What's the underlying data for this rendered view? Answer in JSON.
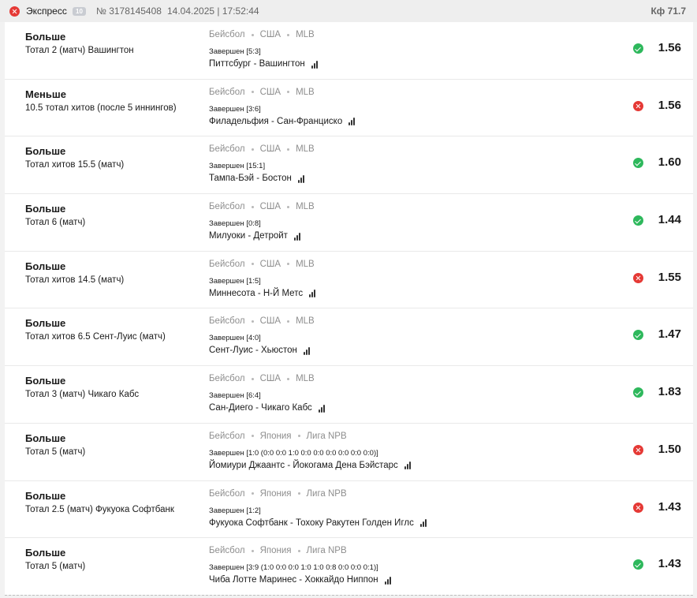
{
  "header": {
    "type": "Экспресс",
    "count": "10",
    "number": "№ 3178145408",
    "datetime": "14.04.2025 | 17:52:44",
    "coef": "Кф 71.7",
    "status": "lost"
  },
  "bets": [
    {
      "pick": "Больше",
      "market": "Тотал 2 (матч) Вашингтон",
      "sport": "Бейсбол",
      "country": "США",
      "league": "MLB",
      "result": "Завершен [5:3]",
      "match": "Питтсбург - Вашингтон",
      "status": "won",
      "odds": "1.56"
    },
    {
      "pick": "Меньше",
      "market": "10.5 тотал хитов (после 5 иннингов)",
      "sport": "Бейсбол",
      "country": "США",
      "league": "MLB",
      "result": "Завершен [3:6]",
      "match": "Филадельфия - Сан-Франциско",
      "status": "lost",
      "odds": "1.56"
    },
    {
      "pick": "Больше",
      "market": "Тотал хитов 15.5 (матч)",
      "sport": "Бейсбол",
      "country": "США",
      "league": "MLB",
      "result": "Завершен [15:1]",
      "match": "Тампа-Бэй - Бостон",
      "status": "won",
      "odds": "1.60"
    },
    {
      "pick": "Больше",
      "market": "Тотал 6 (матч)",
      "sport": "Бейсбол",
      "country": "США",
      "league": "MLB",
      "result": "Завершен [0:8]",
      "match": "Милуоки - Детройт",
      "status": "won",
      "odds": "1.44"
    },
    {
      "pick": "Больше",
      "market": "Тотал хитов 14.5 (матч)",
      "sport": "Бейсбол",
      "country": "США",
      "league": "MLB",
      "result": "Завершен [1:5]",
      "match": "Миннесота - Н-Й Метс",
      "status": "lost",
      "odds": "1.55"
    },
    {
      "pick": "Больше",
      "market": "Тотал хитов 6.5 Сент-Луис (матч)",
      "sport": "Бейсбол",
      "country": "США",
      "league": "MLB",
      "result": "Завершен [4:0]",
      "match": "Сент-Луис - Хьюстон",
      "status": "won",
      "odds": "1.47"
    },
    {
      "pick": "Больше",
      "market": "Тотал 3 (матч) Чикаго Кабс",
      "sport": "Бейсбол",
      "country": "США",
      "league": "MLB",
      "result": "Завершен [6:4]",
      "match": "Сан-Диего - Чикаго Кабс",
      "status": "won",
      "odds": "1.83"
    },
    {
      "pick": "Больше",
      "market": "Тотал 5 (матч)",
      "sport": "Бейсбол",
      "country": "Япония",
      "league": "Лига NPB",
      "result": "Завершен [1:0 (0:0 0:0 1:0 0:0 0:0 0:0 0:0 0:0 0:0)]",
      "match": "Йомиури Джаантс - Йокогама Дена Бэйстарс",
      "status": "lost",
      "odds": "1.50"
    },
    {
      "pick": "Больше",
      "market": "Тотал 2.5 (матч) Фукуока Софтбанк",
      "sport": "Бейсбол",
      "country": "Япония",
      "league": "Лига NPB",
      "result": "Завершен [1:2]",
      "match": "Фукуока Софтбанк - Тохоку Ракутен Голден Иглс",
      "status": "lost",
      "odds": "1.43"
    },
    {
      "pick": "Больше",
      "market": "Тотал 5 (матч)",
      "sport": "Бейсбол",
      "country": "Япония",
      "league": "Лига NPB",
      "result": "Завершен [3:9 (1:0 0:0 0:0 1:0 1:0 0:8 0:0 0:0 0:1)]",
      "match": "Чиба Лотте Маринес - Хоккайдо Ниппон",
      "status": "won",
      "odds": "1.43"
    }
  ]
}
